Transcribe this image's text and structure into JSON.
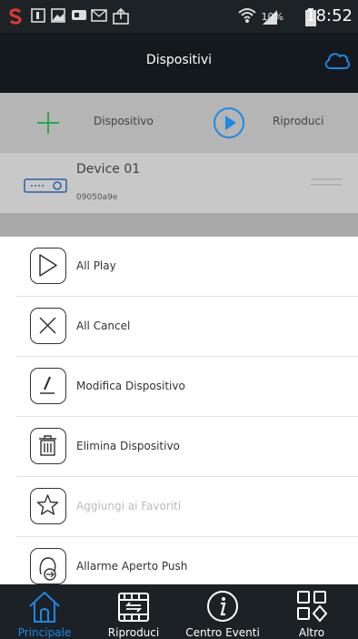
{
  "status_bar": {
    "battery": "10%",
    "time": "18:52"
  },
  "header": {
    "title": "Dispositivi"
  },
  "toolbar": {
    "add_label": "Dispositivo",
    "play_label": "Riproduci"
  },
  "device": {
    "name": "Device 01",
    "serial": "09050a9e"
  },
  "menu": {
    "items": [
      {
        "label": "All Play",
        "icon": "play-icon",
        "enabled": true
      },
      {
        "label": "All Cancel",
        "icon": "close-icon",
        "enabled": true
      },
      {
        "label": "Modifica Dispositivo",
        "icon": "edit-icon",
        "enabled": true
      },
      {
        "label": "Elimina Dispositivo",
        "icon": "trash-icon",
        "enabled": true
      },
      {
        "label": "Aggiungi ai Favoriti",
        "icon": "star-icon",
        "enabled": false
      },
      {
        "label": "Allarme Aperto Push",
        "icon": "alarm-push-icon",
        "enabled": true
      }
    ]
  },
  "tabs": [
    {
      "label": "Principale",
      "icon": "home-icon",
      "active": true
    },
    {
      "label": "Riproduci",
      "icon": "playback-icon",
      "active": false
    },
    {
      "label": "Centro Eventi",
      "icon": "info-icon",
      "active": false
    },
    {
      "label": "Altro",
      "icon": "grid-icon",
      "active": false
    }
  ],
  "colors": {
    "accent": "#1e88e5",
    "header_bg": "#14191e",
    "add_green": "#2aa84a"
  }
}
